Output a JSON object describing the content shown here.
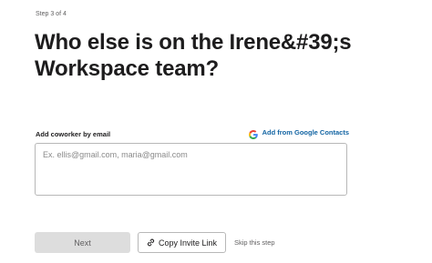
{
  "step": {
    "label": "Step 3 of 4"
  },
  "heading": {
    "text": "Who else is on the Irene&#39;s Workspace team?"
  },
  "invite_form": {
    "field_label": "Add coworker by email",
    "google_contacts_label": "Add from Google Contacts",
    "email_placeholder": "Ex. ellis@gmail.com, maria@gmail.com",
    "email_value": ""
  },
  "actions": {
    "next_label": "Next",
    "copy_invite_label": "Copy Invite Link",
    "skip_label": "Skip this step"
  },
  "colors": {
    "link_blue": "#1264a3",
    "disabled_button_bg": "#dddddd",
    "text_primary": "#1d1c1d",
    "text_secondary": "#616061"
  },
  "icons": {
    "google": "google-icon",
    "link": "link-icon"
  }
}
